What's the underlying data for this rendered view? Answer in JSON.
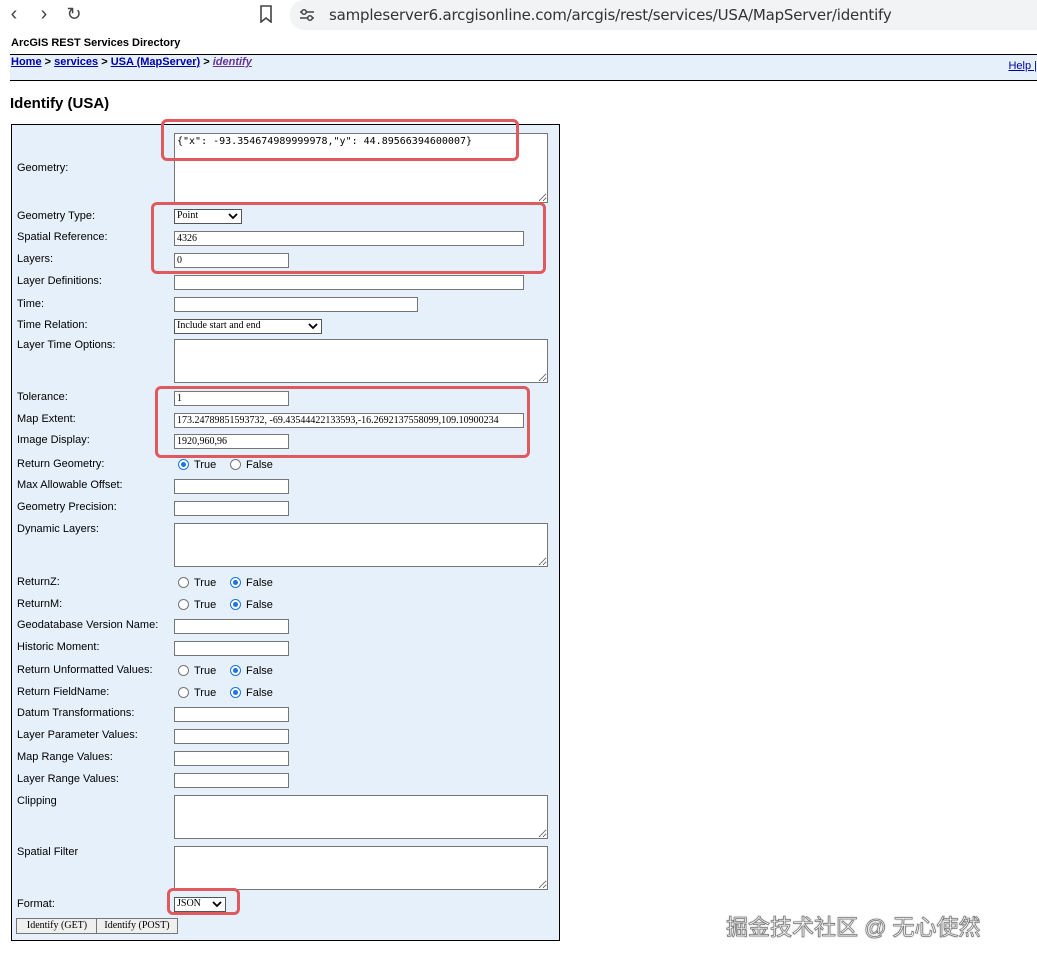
{
  "browser": {
    "url": "sampleserver6.arcgisonline.com/arcgis/rest/services/USA/MapServer/identify",
    "back_icon": "‹",
    "forward_icon": "›",
    "reload_icon": "↻"
  },
  "header": {
    "directory_title": "ArcGIS REST Services Directory",
    "breadcrumb": {
      "home": "Home",
      "sep": " > ",
      "services": "services",
      "service": "USA (MapServer)",
      "current": "identify"
    },
    "help": "Help |"
  },
  "page_title": "Identify (USA)",
  "form": {
    "geometry": {
      "label": "Geometry:",
      "value": "{\"x\": -93.354674989999978,\"y\": 44.89566394600007}"
    },
    "geometry_type": {
      "label": "Geometry Type:",
      "selected": "Point"
    },
    "spatial_reference": {
      "label": "Spatial Reference:",
      "value": "4326"
    },
    "layers": {
      "label": "Layers:",
      "value": "0"
    },
    "layer_definitions": {
      "label": "Layer Definitions:",
      "value": ""
    },
    "time": {
      "label": "Time:",
      "value": ""
    },
    "time_relation": {
      "label": "Time Relation:",
      "selected": "Include start and end"
    },
    "layer_time_options": {
      "label": "Layer Time Options:",
      "value": ""
    },
    "tolerance": {
      "label": "Tolerance:",
      "value": "1"
    },
    "map_extent": {
      "label": "Map Extent:",
      "value": "173.24789851593732, -69.43544422133593,-16.2692137558099,109.10900234"
    },
    "image_display": {
      "label": "Image Display:",
      "value": "1920,960,96"
    },
    "return_geometry": {
      "label": "Return Geometry:",
      "true_label": "True",
      "false_label": "False",
      "selected": "True"
    },
    "max_allowable_offset": {
      "label": "Max Allowable Offset:",
      "value": ""
    },
    "geometry_precision": {
      "label": "Geometry Precision:",
      "value": ""
    },
    "dynamic_layers": {
      "label": "Dynamic Layers:",
      "value": ""
    },
    "return_z": {
      "label": "ReturnZ:",
      "true_label": "True",
      "false_label": "False",
      "selected": "False"
    },
    "return_m": {
      "label": "ReturnM:",
      "true_label": "True",
      "false_label": "False",
      "selected": "False"
    },
    "gdb_version": {
      "label": "Geodatabase Version Name:",
      "value": ""
    },
    "historic_moment": {
      "label": "Historic Moment:",
      "value": ""
    },
    "return_unformatted": {
      "label": "Return Unformatted Values:",
      "true_label": "True",
      "false_label": "False",
      "selected": "False"
    },
    "return_fieldname": {
      "label": "Return FieldName:",
      "true_label": "True",
      "false_label": "False",
      "selected": "False"
    },
    "datum_transformations": {
      "label": "Datum Transformations:",
      "value": ""
    },
    "layer_parameter_values": {
      "label": "Layer Parameter Values:",
      "value": ""
    },
    "map_range_values": {
      "label": "Map Range Values:",
      "value": ""
    },
    "layer_range_values": {
      "label": "Layer Range Values:",
      "value": ""
    },
    "clipping": {
      "label": "Clipping",
      "value": ""
    },
    "spatial_filter": {
      "label": "Spatial Filter",
      "value": ""
    },
    "format": {
      "label": "Format:",
      "selected": "JSON"
    },
    "identify_get": "Identify (GET)",
    "identify_post": "Identify (POST)"
  },
  "watermark": "掘金技术社区 @ 无心使然",
  "colors": {
    "highlight": "#e0595e",
    "form_bg": "#e6f0fa",
    "radio_selected": "#1a73e8"
  }
}
